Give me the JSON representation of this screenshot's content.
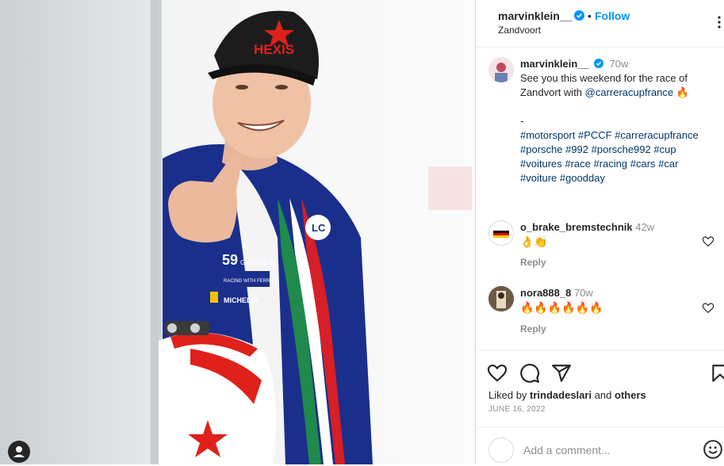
{
  "post": {
    "author": "marvinklein__",
    "follow_label": "Follow",
    "dot": "•",
    "location": "Zandvoort",
    "caption_author": "marvinklein__",
    "caption_time": "70w",
    "caption_lines": [
      "See you this weekend for the race of",
      "Zandvort with ",
      "@carreracupfrance",
      " 🔥"
    ],
    "caption_dash": "-",
    "hashtags": [
      "#motorsport #PCCF #carreracupfrance",
      "#porsche #992 #porsche992 #cup",
      "#voitures #race #racing #cars #car",
      "#voiture #goodday"
    ]
  },
  "comments": [
    {
      "user": "o_brake_bremstechnik",
      "time": "42w",
      "text": "👌👏",
      "reply": "Reply"
    },
    {
      "user": "nora888_8",
      "time": "70w",
      "text": "🔥🔥🔥🔥🔥🔥",
      "reply": "Reply"
    }
  ],
  "likes": {
    "prefix": "Liked by ",
    "user": "trindadeslari",
    "middle": " and ",
    "others": "others"
  },
  "date": "JUNE 16, 2022",
  "add_comment_placeholder": "Add a comment...",
  "photo_text": {
    "cap": "HEXIS",
    "badge": "59",
    "suit_line": "GARAGE 59",
    "sponsor1": "RACING WITH FERRARI",
    "sponsor2": "MICHELIN"
  },
  "colors": {
    "accent": "#0095f6",
    "text": "#262626",
    "muted": "#8e8e8e",
    "suit": "#1a2f8c",
    "cap_red": "#e0201b"
  },
  "icons": [
    "verified-icon",
    "more-icon",
    "heart-icon",
    "comment-icon",
    "share-icon",
    "bookmark-icon",
    "emoji-icon",
    "account-icon"
  ]
}
